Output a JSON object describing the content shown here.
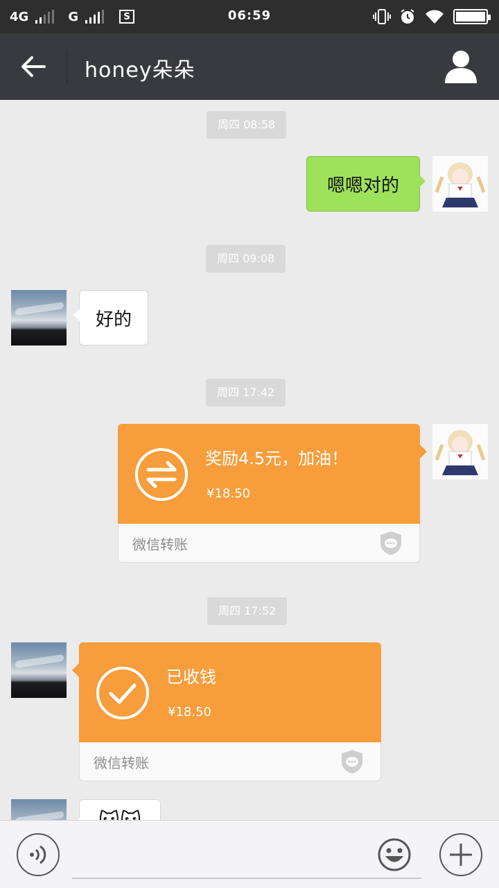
{
  "status_bar": {
    "network_1": "4G",
    "network_2": "G",
    "time": "06:59",
    "icons": [
      "signal-icon",
      "signal-icon",
      "sim-icon",
      "vibrate-icon",
      "alarm-icon",
      "wifi-icon",
      "battery-icon"
    ]
  },
  "header": {
    "title": "honey朵朵",
    "back_icon": "arrow-left-icon",
    "profile_icon": "person-icon"
  },
  "messages": [
    {
      "type": "timestamp",
      "text": "周四 08:58"
    },
    {
      "type": "text",
      "side": "right",
      "text": "嗯嗯对的"
    },
    {
      "type": "timestamp",
      "text": "周四 09:08"
    },
    {
      "type": "text",
      "side": "left",
      "text": "好的"
    },
    {
      "type": "timestamp",
      "text": "周四 17:42"
    },
    {
      "type": "transfer",
      "side": "right",
      "title": "奖励4.5元，加油！",
      "amount": "¥18.50",
      "label": "微信转账",
      "icon": "transfer-icon"
    },
    {
      "type": "timestamp",
      "text": "周四 17:52"
    },
    {
      "type": "transfer",
      "side": "left",
      "title": "已收钱",
      "amount": "¥18.50",
      "label": "微信转账",
      "icon": "check-icon"
    },
    {
      "type": "sticker",
      "side": "left",
      "content": "🐱🐱"
    }
  ],
  "input_bar": {
    "voice_icon": "voice-icon",
    "emoji_icon": "emoji-icon",
    "plus_icon": "plus-icon",
    "text": ""
  },
  "colors": {
    "title_bar": "#393a3f",
    "status_bar": "#2e2e2e",
    "background": "#ebebeb",
    "sent_bubble": "#9ee25c",
    "transfer_card": "#f79d3b"
  }
}
